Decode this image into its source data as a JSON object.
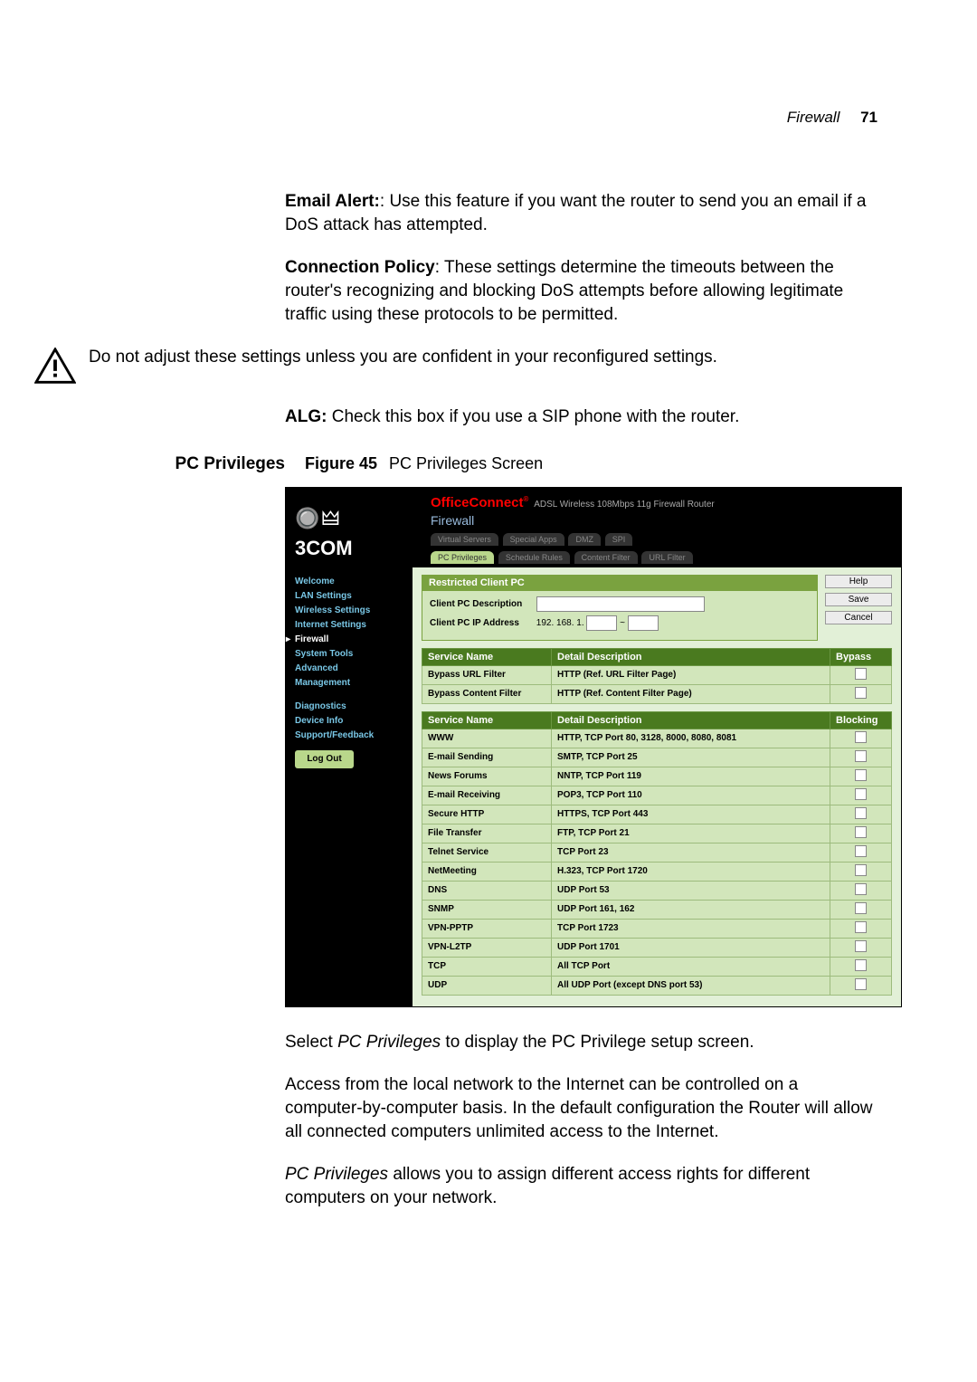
{
  "running_head": {
    "section": "Firewall",
    "page": "71"
  },
  "paragraphs": {
    "email_alert_label": "Email Alert:",
    "email_alert_text": ": Use this feature if you want the router to send you an email if a DoS attack has attempted.",
    "conn_policy_label": "Connection Policy",
    "conn_policy_text": ": These settings determine the timeouts between the router's recognizing and blocking DoS attempts before allowing legitimate traffic using these protocols to be permitted.",
    "caution_text": "Do not adjust these settings unless you are confident in your reconfigured settings.",
    "alg_label": "ALG:",
    "alg_text": " Check this box if you use a SIP phone with the router."
  },
  "section_label": "PC Privileges",
  "figure": {
    "num": "Figure 45",
    "caption": "PC Privileges Screen"
  },
  "after_fig": {
    "p1a": "Select ",
    "p1i": "PC Privileges",
    "p1b": " to display the PC Privilege setup screen.",
    "p2": "Access from the local network to the Internet can be controlled on a computer-by-computer basis. In the default configuration the Router will allow all connected computers unlimited access to the Internet.",
    "p3a": "PC Privileges",
    "p3b": " allows you to assign different access rights for different computers on your network."
  },
  "screenshot": {
    "brand_glyphs": "🔘🜲",
    "brand": "3COM",
    "product": "OfficeConnect",
    "product_sub": "ADSL Wireless 108Mbps 11g Firewall Router",
    "crumb": "Firewall",
    "tabs_row1": [
      "Virtual Servers",
      "Special Apps",
      "DMZ",
      "SPI"
    ],
    "tabs_row2": [
      "PC Privileges",
      "Schedule Rules",
      "Content Filter",
      "URL Filter"
    ],
    "active_tab": "PC Privileges",
    "nav": [
      "Welcome",
      "LAN Settings",
      "Wireless Settings",
      "Internet Settings",
      "Firewall",
      "System Tools",
      "Advanced",
      "Management"
    ],
    "nav2": [
      "Diagnostics",
      "Device Info",
      "Support/Feedback"
    ],
    "logout": "Log Out",
    "panel_title": "Restricted Client PC",
    "client_desc_label": "Client PC Description",
    "client_ip_label": "Client PC IP Address",
    "client_ip_prefix": "192. 168. 1.",
    "ip_sep": "~",
    "buttons": {
      "help": "Help",
      "save": "Save",
      "cancel": "Cancel"
    },
    "bypass_header": {
      "c1": "Service Name",
      "c2": "Detail Description",
      "c3": "Bypass"
    },
    "bypass_rows": [
      {
        "n": "Bypass URL Filter",
        "d": "HTTP (Ref. URL Filter Page)"
      },
      {
        "n": "Bypass Content Filter",
        "d": "HTTP (Ref. Content Filter Page)"
      }
    ],
    "block_header": {
      "c1": "Service Name",
      "c2": "Detail Description",
      "c3": "Blocking"
    },
    "block_rows": [
      {
        "n": "WWW",
        "d": "HTTP, TCP Port 80, 3128, 8000, 8080, 8081"
      },
      {
        "n": "E-mail Sending",
        "d": "SMTP, TCP Port 25"
      },
      {
        "n": "News Forums",
        "d": "NNTP, TCP Port 119"
      },
      {
        "n": "E-mail Receiving",
        "d": "POP3, TCP Port 110"
      },
      {
        "n": "Secure HTTP",
        "d": "HTTPS, TCP Port 443"
      },
      {
        "n": "File Transfer",
        "d": "FTP, TCP Port 21"
      },
      {
        "n": "Telnet Service",
        "d": "TCP Port 23"
      },
      {
        "n": "NetMeeting",
        "d": "H.323, TCP Port 1720"
      },
      {
        "n": "DNS",
        "d": "UDP Port 53"
      },
      {
        "n": "SNMP",
        "d": "UDP Port 161, 162"
      },
      {
        "n": "VPN-PPTP",
        "d": "TCP Port 1723"
      },
      {
        "n": "VPN-L2TP",
        "d": "UDP Port 1701"
      },
      {
        "n": "TCP",
        "d": "All TCP Port"
      },
      {
        "n": "UDP",
        "d": "All UDP Port (except DNS port 53)"
      }
    ]
  }
}
